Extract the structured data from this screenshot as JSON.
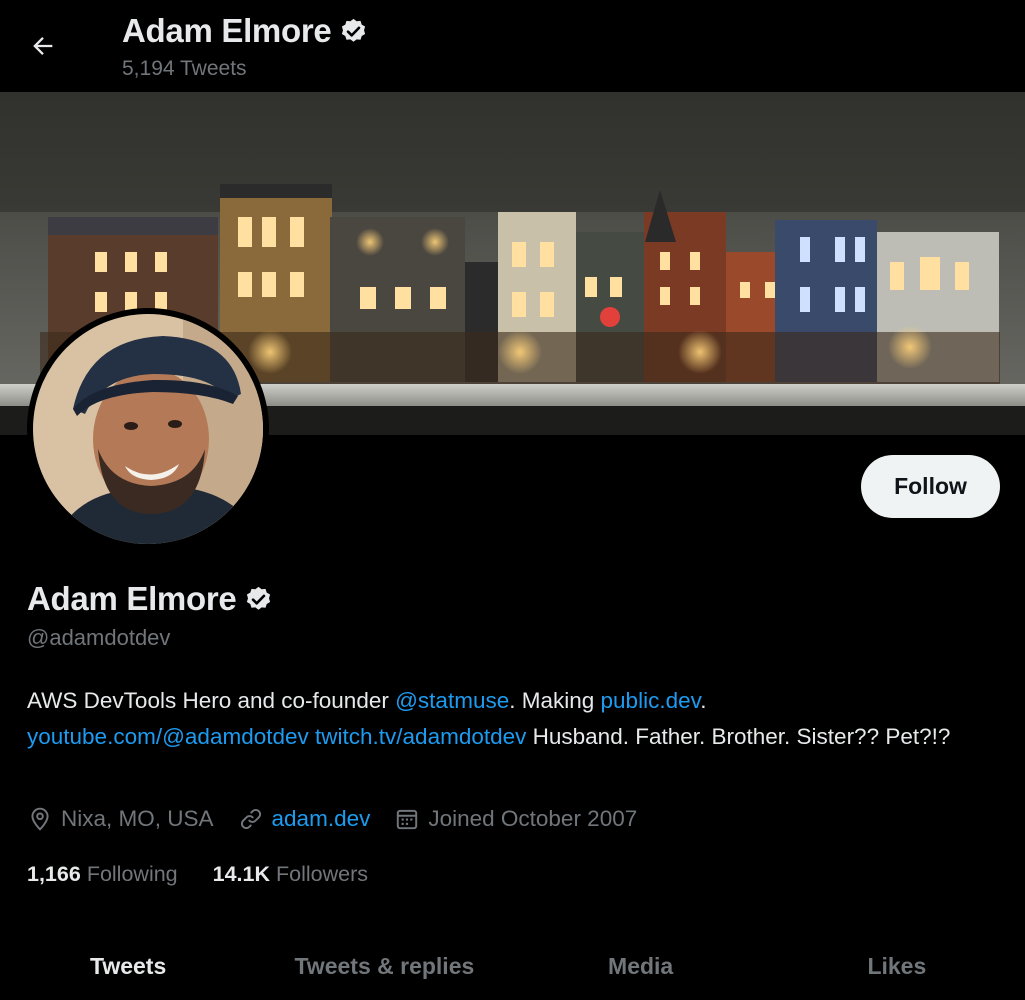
{
  "header": {
    "name": "Adam Elmore",
    "tweet_count": "5,194 Tweets"
  },
  "profile": {
    "name": "Adam Elmore",
    "handle": "@adamdotdev",
    "follow_label": "Follow",
    "bio": {
      "t1": "AWS DevTools Hero and co-founder ",
      "link1": "@statmuse",
      "t2": ". Making ",
      "link2": "public.dev",
      "t3": ".",
      "link3": "youtube.com/@adamdotdev",
      "t4": " ",
      "link4": "twitch.tv/adamdotdev",
      "t5": " Husband. Father. Brother. Sister?? Pet?!?"
    },
    "location": "Nixa, MO, USA",
    "website": "adam.dev",
    "joined": "Joined October 2007",
    "following_count": "1,166",
    "following_label": "Following",
    "followers_count": "14.1K",
    "followers_label": "Followers"
  },
  "tabs": [
    {
      "label": "Tweets",
      "active": true
    },
    {
      "label": "Tweets & replies",
      "active": false
    },
    {
      "label": "Media",
      "active": false
    },
    {
      "label": "Likes",
      "active": false
    }
  ],
  "icons": {
    "back": "arrow-left-icon",
    "verified": "verified-badge-icon",
    "location": "location-pin-icon",
    "link": "link-icon",
    "calendar": "calendar-icon"
  },
  "colors": {
    "background": "#000000",
    "text": "#e7e9ea",
    "muted": "#71767b",
    "link": "#1d9bf0",
    "button_bg": "#eff3f4"
  }
}
